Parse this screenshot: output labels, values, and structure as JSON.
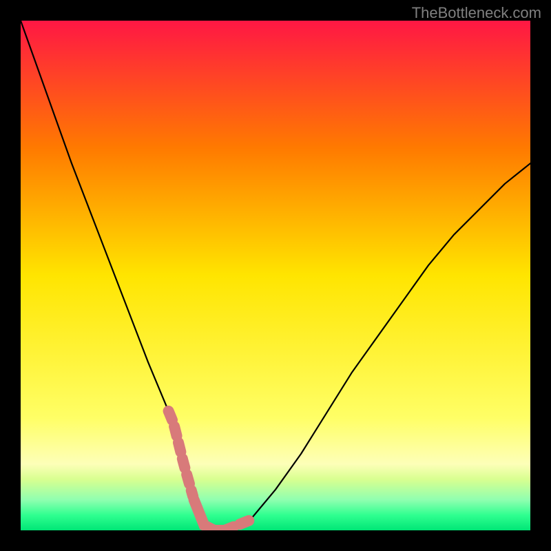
{
  "watermark": "TheBottleneck.com",
  "chart_data": {
    "type": "line",
    "title": "",
    "xlabel": "",
    "ylabel": "",
    "xlim": [
      0,
      100
    ],
    "ylim": [
      0,
      100
    ],
    "x": [
      0,
      5,
      10,
      15,
      20,
      25,
      30,
      32,
      34,
      36,
      38,
      40,
      45,
      50,
      55,
      60,
      65,
      70,
      75,
      80,
      85,
      90,
      95,
      100
    ],
    "values": [
      100,
      86,
      72,
      59,
      46,
      33,
      21,
      13,
      6,
      1,
      0,
      0,
      2,
      8,
      15,
      23,
      31,
      38,
      45,
      52,
      58,
      63,
      68,
      72
    ],
    "optimal_range_x": [
      32,
      42
    ],
    "highlight_points_x": [
      30,
      31,
      32,
      33,
      40,
      41,
      42,
      43
    ],
    "gradient_stops": [
      {
        "offset": 0,
        "color": "#ff1744"
      },
      {
        "offset": 0.25,
        "color": "#ff7a00"
      },
      {
        "offset": 0.5,
        "color": "#ffe500"
      },
      {
        "offset": 0.78,
        "color": "#ffff66"
      },
      {
        "offset": 0.87,
        "color": "#fdffb8"
      },
      {
        "offset": 0.9,
        "color": "#d8ff90"
      },
      {
        "offset": 0.94,
        "color": "#90ffb0"
      },
      {
        "offset": 0.97,
        "color": "#30ff90"
      },
      {
        "offset": 1.0,
        "color": "#00e676"
      }
    ]
  }
}
